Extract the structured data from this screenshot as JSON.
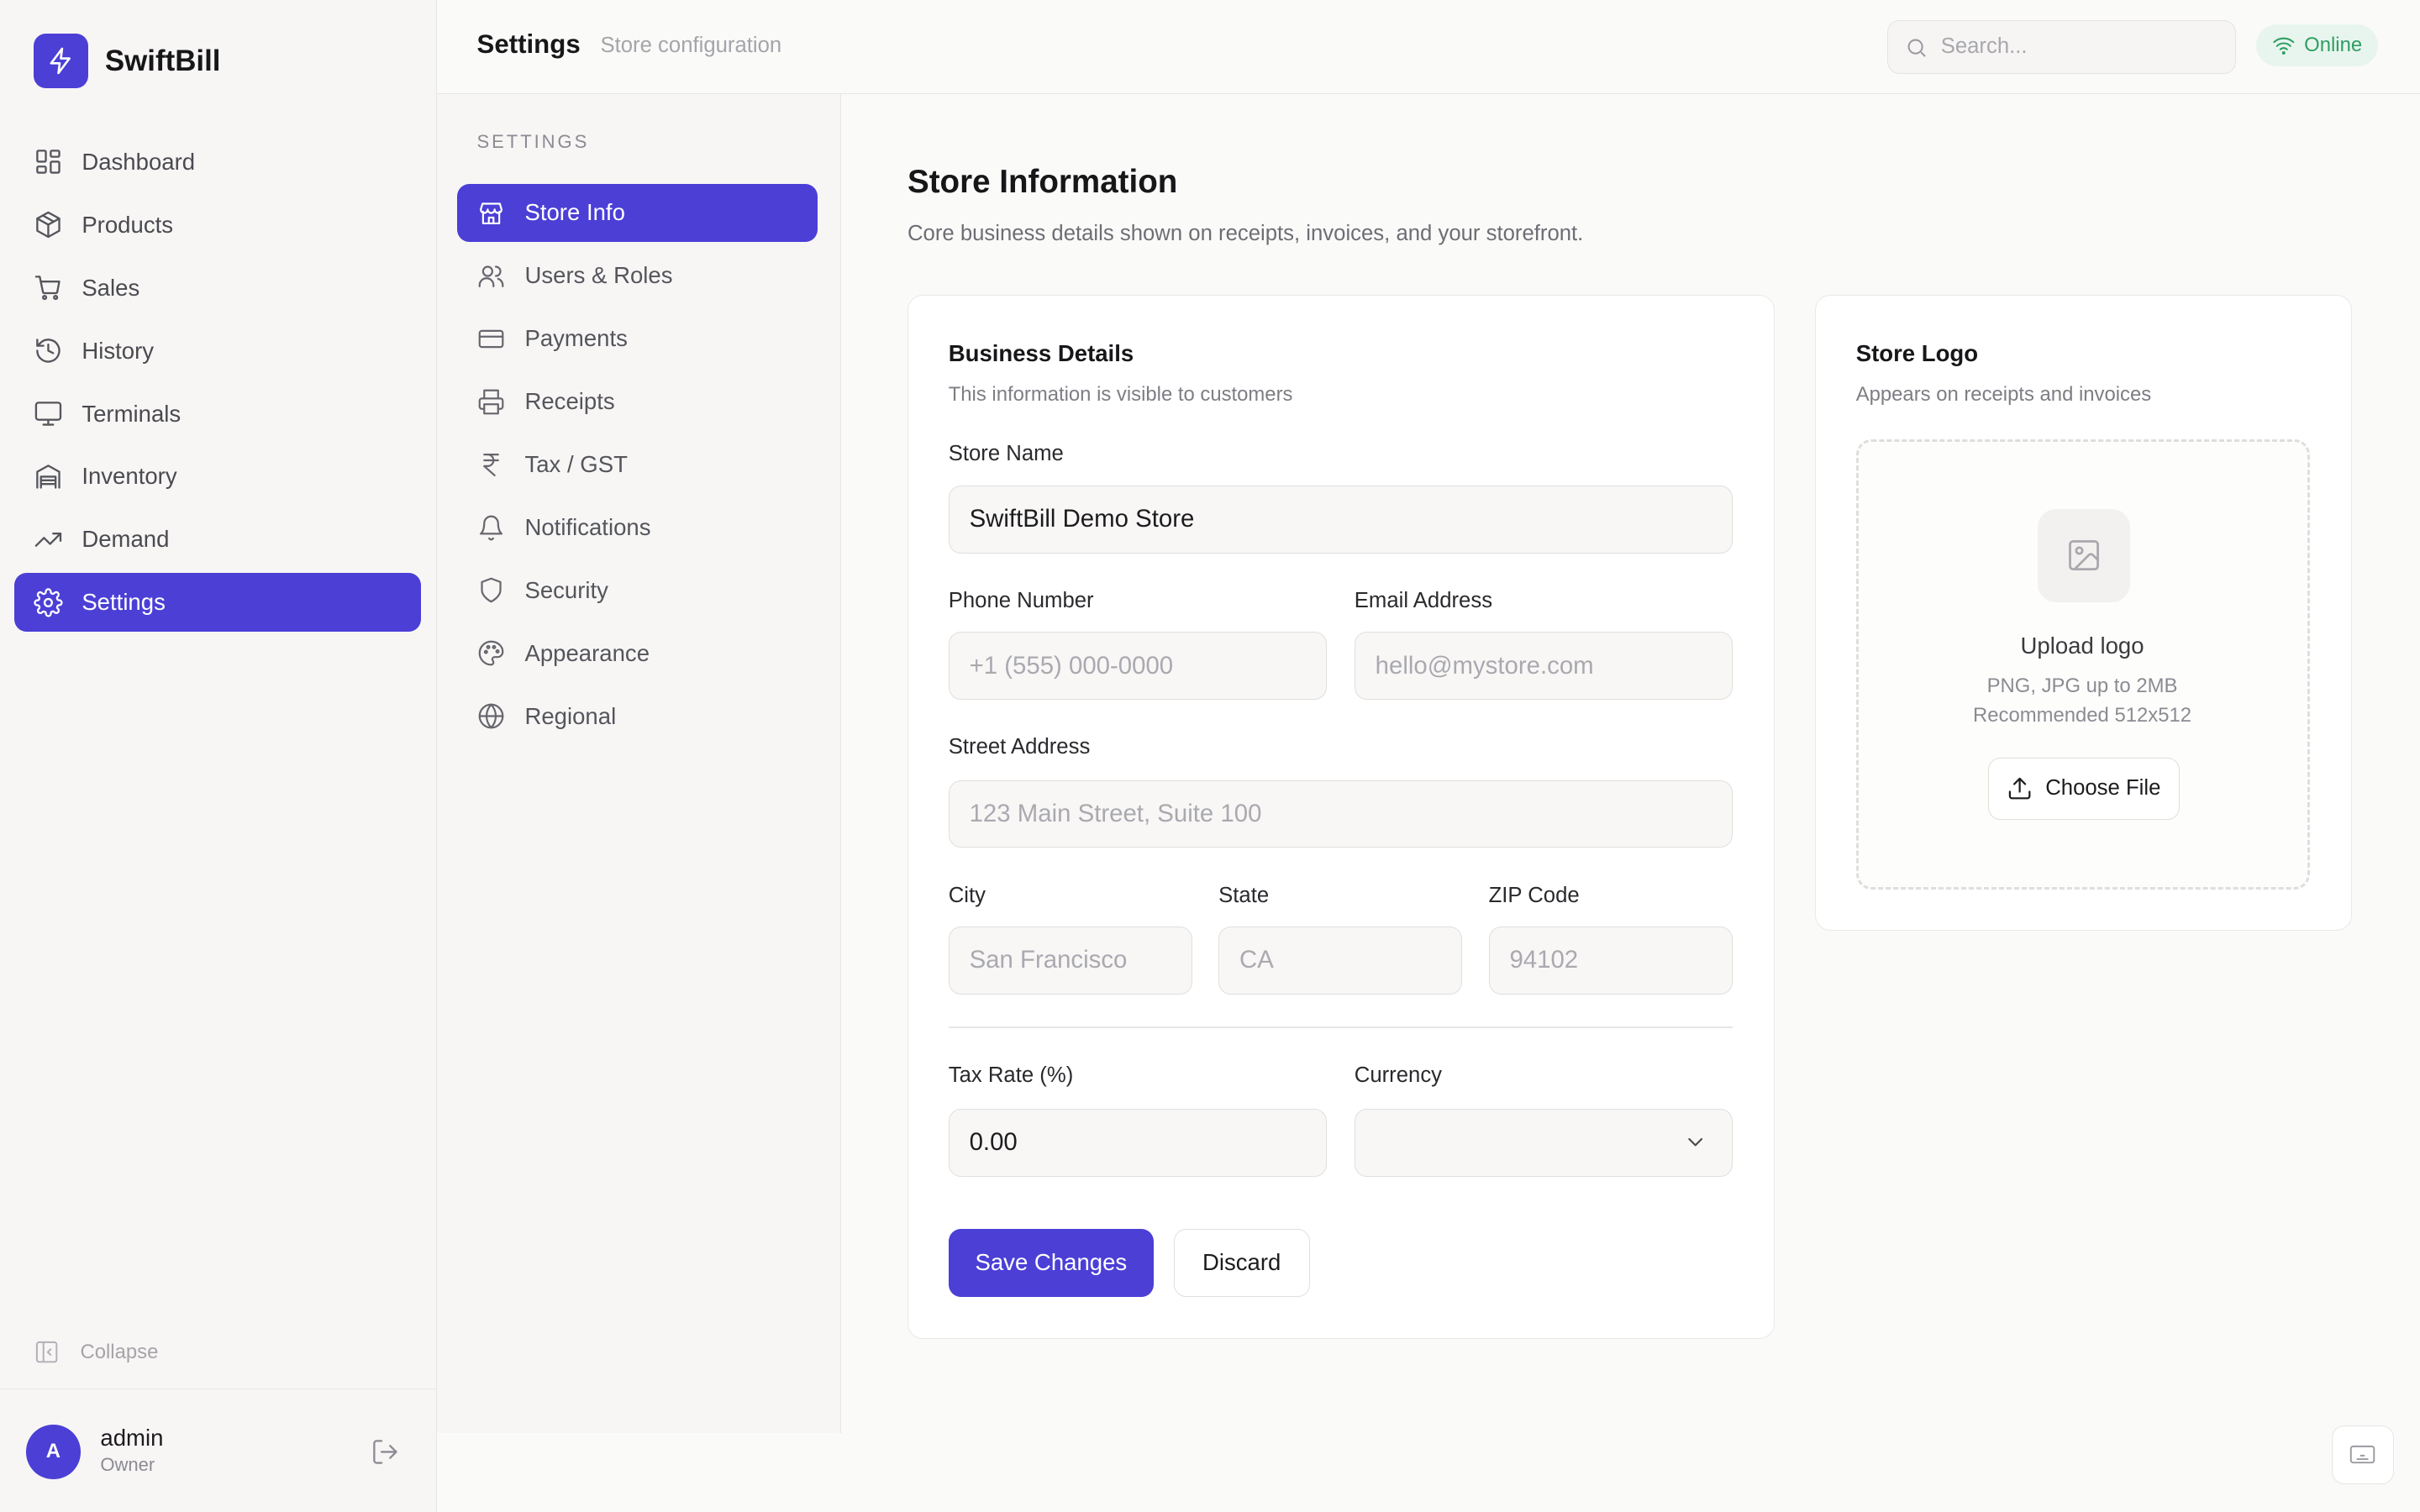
{
  "app": {
    "name": "SwiftBill"
  },
  "sidebar": {
    "items": [
      {
        "label": "Dashboard",
        "icon": "dashboard-icon"
      },
      {
        "label": "Products",
        "icon": "package-icon"
      },
      {
        "label": "Sales",
        "icon": "cart-icon"
      },
      {
        "label": "History",
        "icon": "history-icon"
      },
      {
        "label": "Terminals",
        "icon": "monitor-icon"
      },
      {
        "label": "Inventory",
        "icon": "warehouse-icon"
      },
      {
        "label": "Demand",
        "icon": "trending-up-icon"
      },
      {
        "label": "Settings",
        "icon": "gear-icon",
        "active": true
      }
    ],
    "collapse_label": "Collapse",
    "user": {
      "initial": "A",
      "name": "admin",
      "role": "Owner"
    }
  },
  "header": {
    "title": "Settings",
    "subtitle": "Store configuration",
    "search_placeholder": "Search...",
    "status": "Online"
  },
  "settings_nav": {
    "heading": "SETTINGS",
    "items": [
      {
        "label": "Store Info",
        "icon": "store-icon",
        "active": true
      },
      {
        "label": "Users & Roles",
        "icon": "users-icon"
      },
      {
        "label": "Payments",
        "icon": "credit-card-icon"
      },
      {
        "label": "Receipts",
        "icon": "printer-icon"
      },
      {
        "label": "Tax / GST",
        "icon": "rupee-icon"
      },
      {
        "label": "Notifications",
        "icon": "bell-icon"
      },
      {
        "label": "Security",
        "icon": "shield-icon"
      },
      {
        "label": "Appearance",
        "icon": "palette-icon"
      },
      {
        "label": "Regional",
        "icon": "globe-icon"
      }
    ]
  },
  "main": {
    "title": "Store Information",
    "description": "Core business details shown on receipts, invoices, and your storefront.",
    "business": {
      "title": "Business Details",
      "subtitle": "This information is visible to customers",
      "store_name": {
        "label": "Store Name",
        "value": "SwiftBill Demo Store"
      },
      "phone": {
        "label": "Phone Number",
        "placeholder": "+1 (555) 000-0000"
      },
      "email": {
        "label": "Email Address",
        "placeholder": "hello@mystore.com"
      },
      "street": {
        "label": "Street Address",
        "placeholder": "123 Main Street, Suite 100"
      },
      "city": {
        "label": "City",
        "placeholder": "San Francisco"
      },
      "state": {
        "label": "State",
        "placeholder": "CA"
      },
      "zip": {
        "label": "ZIP Code",
        "placeholder": "94102"
      },
      "tax_rate": {
        "label": "Tax Rate (%)",
        "value": "0.00"
      },
      "currency": {
        "label": "Currency",
        "value": ""
      },
      "save_label": "Save Changes",
      "discard_label": "Discard"
    },
    "logo": {
      "title": "Store Logo",
      "subtitle": "Appears on receipts and invoices",
      "upload_title": "Upload logo",
      "hint_formats": "PNG, JPG up to 2MB",
      "hint_size": "Recommended 512x512",
      "choose_label": "Choose File"
    }
  },
  "colors": {
    "accent": "#4b3fd6",
    "status_online": "#2f9e62"
  }
}
